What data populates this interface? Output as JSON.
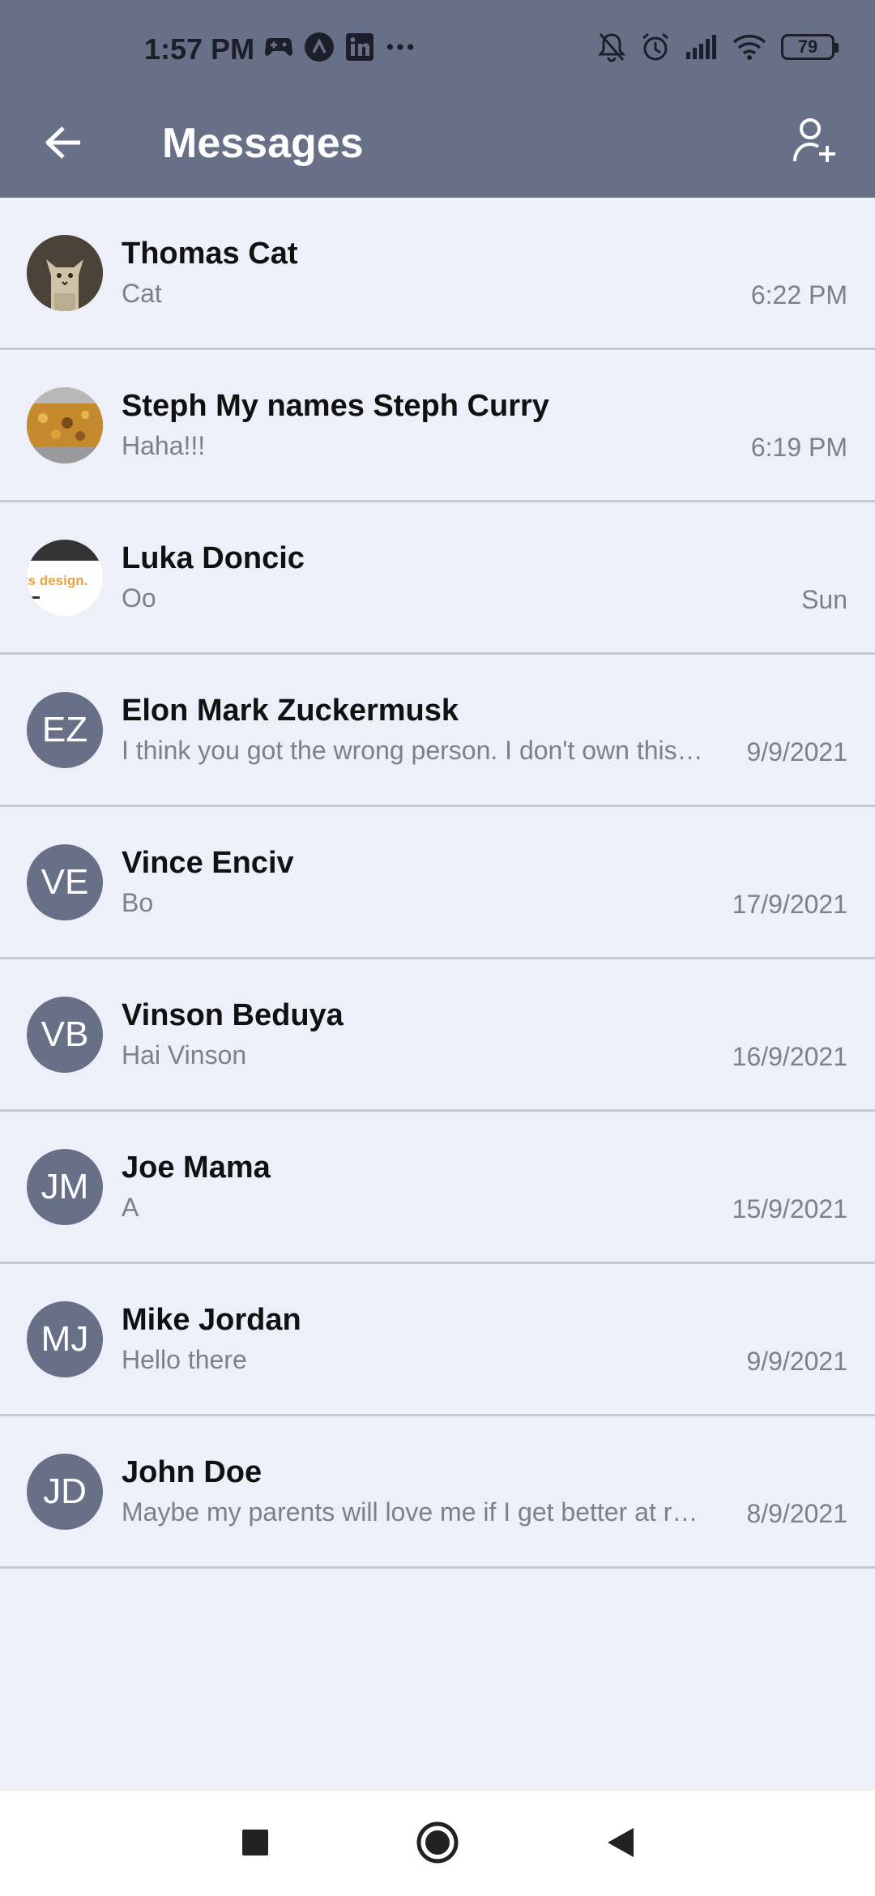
{
  "status_bar": {
    "time": "1:57 PM",
    "battery": "79",
    "left_icons": [
      "gamepad-icon",
      "app-a-icon",
      "linkedin-icon",
      "more-dots-icon"
    ],
    "right_icons": [
      "bell-off-icon",
      "alarm-icon",
      "signal-icon",
      "wifi-icon"
    ]
  },
  "header": {
    "title": "Messages",
    "back_icon": "arrow-left-icon",
    "add_icon": "add-person-icon",
    "background": "#687088"
  },
  "conversations": [
    {
      "name": "Thomas Cat",
      "preview": "Cat",
      "time": "6:22 PM",
      "initials": "",
      "avatar": "photo-cat"
    },
    {
      "name": "Steph My names Steph Curry",
      "preview": "Haha!!!",
      "time": "6:19 PM",
      "initials": "",
      "avatar": "photo-food"
    },
    {
      "name": "Luka Doncic",
      "preview": "Oo",
      "time": "Sun",
      "initials": "",
      "avatar": "photo-design",
      "avatar_text": "ts design."
    },
    {
      "name": "Elon Mark Zuckermusk",
      "preview": "I think you got the wrong person. I don't own this company.",
      "time": "9/9/2021",
      "initials": "EZ"
    },
    {
      "name": "Vince Enciv",
      "preview": "Bo",
      "time": "17/9/2021",
      "initials": "VE"
    },
    {
      "name": "Vinson Beduya",
      "preview": "Hai Vinson",
      "time": "16/9/2021",
      "initials": "VB"
    },
    {
      "name": "Joe Mama",
      "preview": "A",
      "time": "15/9/2021",
      "initials": "JM"
    },
    {
      "name": "Mike Jordan",
      "preview": "Hello there",
      "time": "9/9/2021",
      "initials": "MJ"
    },
    {
      "name": "John Doe",
      "preview": "Maybe my parents will love me if I get better at reading",
      "time": "8/9/2021",
      "initials": "JD"
    }
  ],
  "nav": {
    "recents_icon": "square-icon",
    "home_icon": "circle-icon",
    "back_icon": "triangle-back-icon"
  }
}
